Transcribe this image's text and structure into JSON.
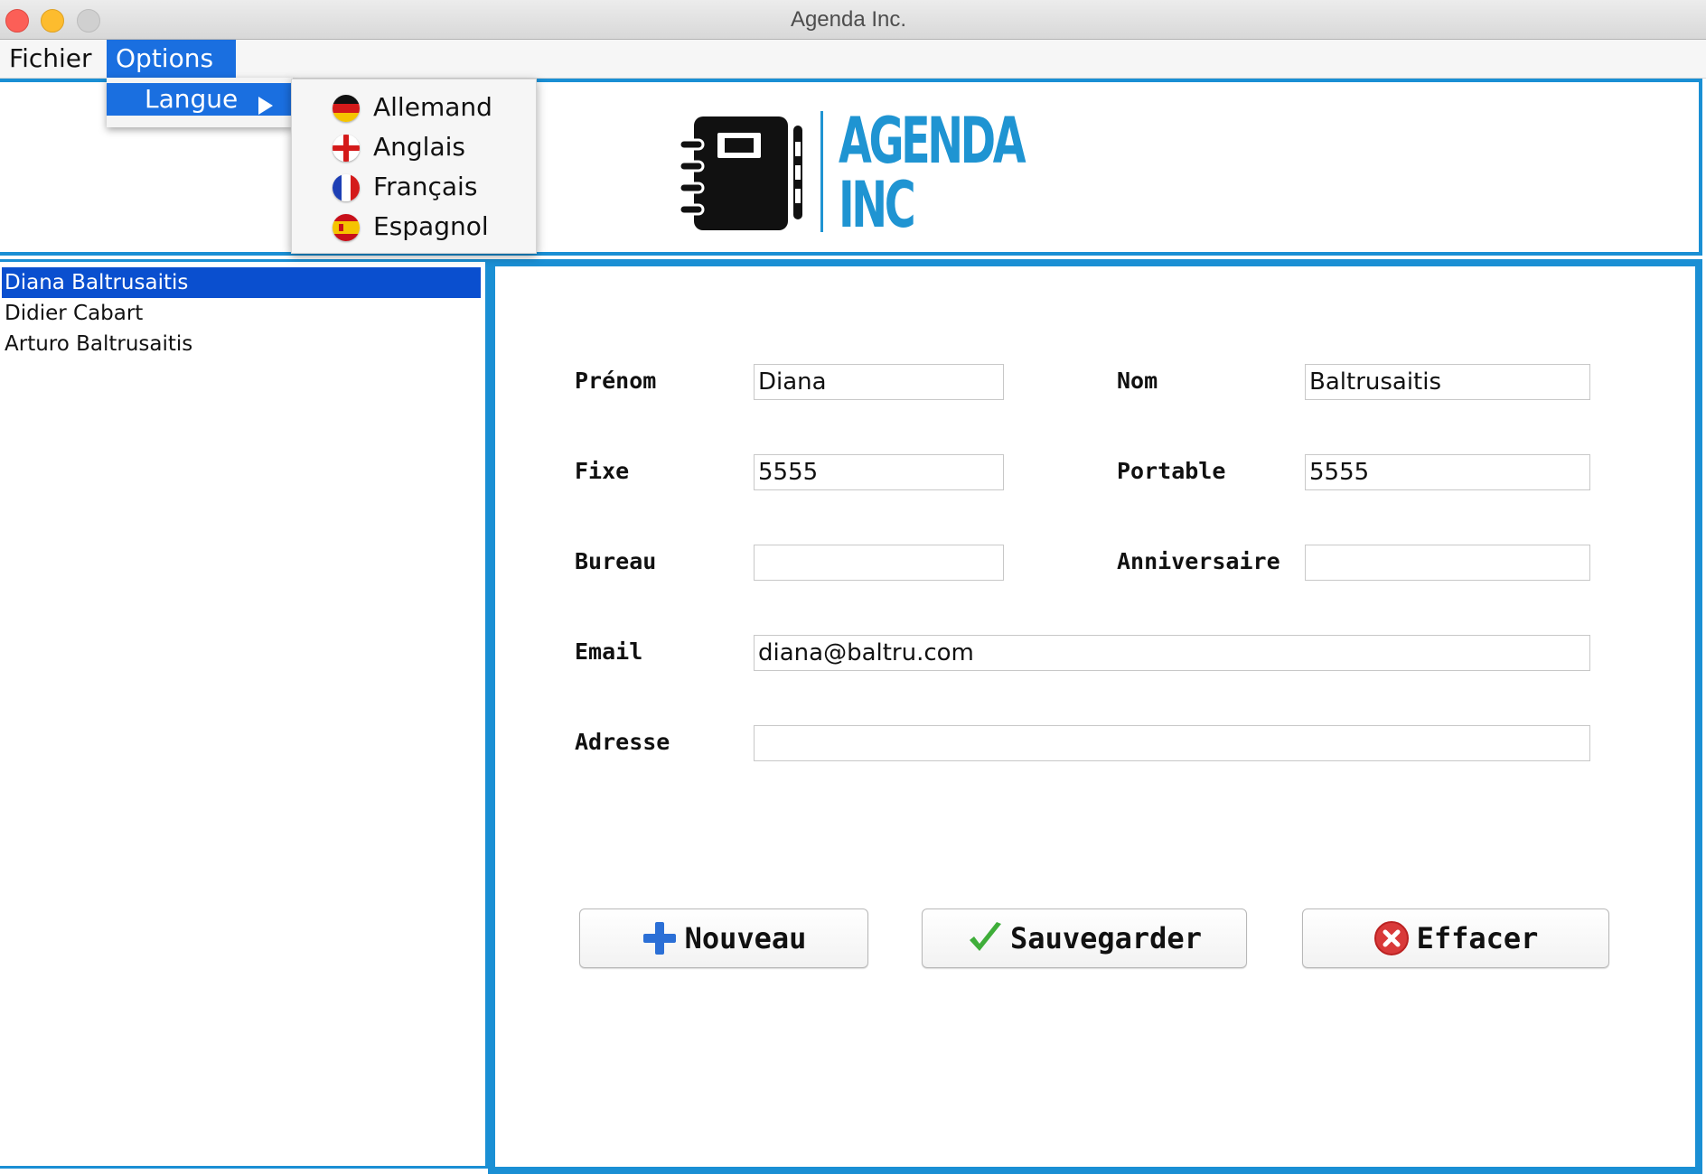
{
  "window": {
    "title": "Agenda Inc."
  },
  "menubar": {
    "fichier": "Fichier",
    "options": "Options"
  },
  "options_menu": {
    "langue": "Langue"
  },
  "langue_submenu": [
    "Allemand",
    "Anglais",
    "Français",
    "Espagnol"
  ],
  "logo": {
    "line1": "AGENDA",
    "line2": "INC"
  },
  "contacts": [
    "Diana Baltrusaitis",
    "Didier Cabart",
    "Arturo Baltrusaitis"
  ],
  "form": {
    "prenom_label": "Prénom",
    "prenom_value": "Diana",
    "nom_label": "Nom",
    "nom_value": "Baltrusaitis",
    "fixe_label": "Fixe",
    "fixe_value": "5555",
    "portable_label": "Portable",
    "portable_value": "5555",
    "bureau_label": "Bureau",
    "bureau_value": "",
    "anniversaire_label": "Anniversaire",
    "anniversaire_value": "",
    "email_label": "Email",
    "email_value": "diana@baltru.com",
    "adresse_label": "Adresse",
    "adresse_value": ""
  },
  "buttons": {
    "nouveau": "Nouveau",
    "sauvegarder": "Sauvegarder",
    "effacer": "Effacer"
  },
  "colors": {
    "accent": "#1a8fd4",
    "selection": "#0a4fcf",
    "menu_highlight": "#1a6fe0"
  }
}
